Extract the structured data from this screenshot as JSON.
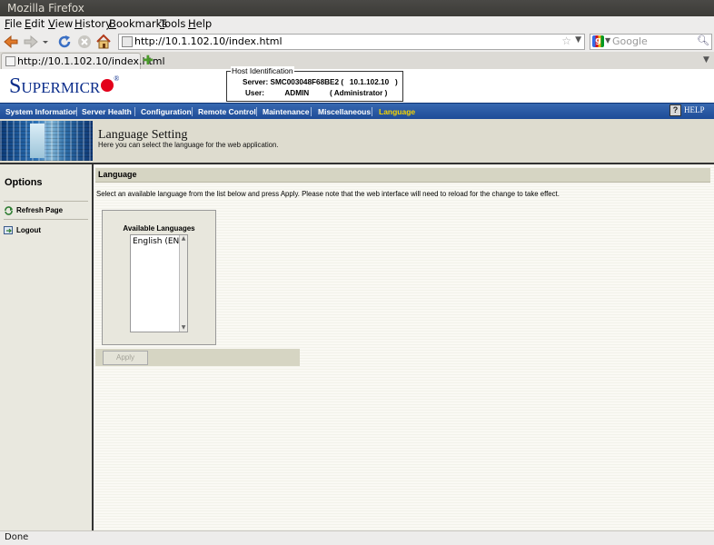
{
  "window": {
    "title": "Mozilla Firefox"
  },
  "menubar": {
    "items": [
      "File",
      "Edit",
      "View",
      "History",
      "Bookmarks",
      "Tools",
      "Help"
    ]
  },
  "navbar": {
    "url": "http://10.1.102.10/index.html",
    "search_placeholder": "Google"
  },
  "tabs": [
    {
      "label": "http://10.1.102.10/index.html"
    }
  ],
  "header": {
    "logo_text": "SUPERMICR",
    "host": {
      "legend": "Host Identification",
      "server_label": "Server:",
      "server_value": "SMC003048F68BE2",
      "server_ip": "10.1.102.10",
      "user_label": "User:",
      "user_value": "ADMIN",
      "user_role": "Administrator"
    }
  },
  "mainnav": {
    "items": [
      "System Information",
      "Server Health",
      "Configuration",
      "Remote Control",
      "Maintenance",
      "Miscellaneous",
      "Language"
    ],
    "active": "Language",
    "help_label": "HELP",
    "active_color": "#f5d400"
  },
  "banner": {
    "title": "Language Setting",
    "subtitle": "Here you can select the language for the web application."
  },
  "sidebar": {
    "title": "Options",
    "links": [
      {
        "label": "Refresh Page",
        "icon": "refresh-icon"
      },
      {
        "label": "Logout",
        "icon": "logout-icon"
      }
    ]
  },
  "language_section": {
    "header": "Language",
    "instructions": "Select an available language from the list below and press Apply. Please note that the web interface will need to reload for the change to take effect.",
    "list_label": "Available Languages",
    "languages": [
      "English (EN)"
    ],
    "apply_label": "Apply"
  },
  "status": {
    "text": "Done"
  }
}
